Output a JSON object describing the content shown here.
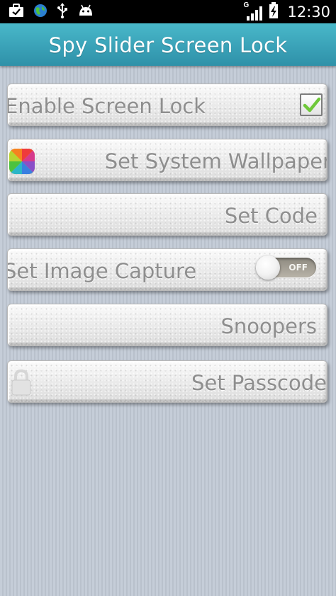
{
  "status_bar": {
    "time": "12:30",
    "network_type": "G",
    "icons": [
      "briefcase-check-icon",
      "globe-icon",
      "usb-icon",
      "android-icon",
      "signal-icon",
      "battery-charging-icon"
    ]
  },
  "app_bar": {
    "title": "Spy Slider Screen Lock",
    "color": "#3aa2b8"
  },
  "menu": {
    "enable_screen_lock": {
      "label": "Enable Screen Lock",
      "checked": true
    },
    "set_system_wallpaper": {
      "label": "Set System Wallpaper",
      "icon": "wallpaper-color-icon"
    },
    "set_code": {
      "label": "Set Code"
    },
    "set_image_capture": {
      "label": "Set Image Capture",
      "toggle_text": "OFF",
      "enabled": false
    },
    "snoopers": {
      "label": "Snoopers"
    },
    "set_passcode": {
      "label": "Set Passcode",
      "icon": "lock-icon"
    }
  }
}
